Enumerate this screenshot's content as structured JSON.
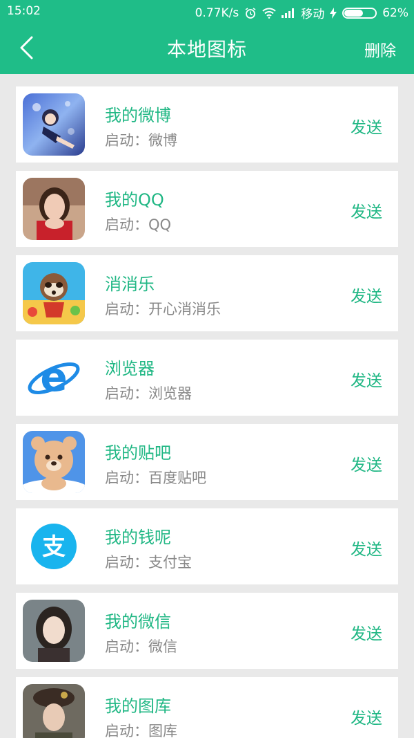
{
  "status": {
    "time": "15:02",
    "speed": "0.77K/s",
    "carrier": "移动",
    "battery": "62%",
    "battery_level": 0.62
  },
  "navbar": {
    "back": "back-arrow",
    "title": "本地图标",
    "action": "删除"
  },
  "items": [
    {
      "title": "我的微博",
      "sub": "启动：微博",
      "send": "发送",
      "icon": "anime-girl-thumbnail"
    },
    {
      "title": "我的QQ",
      "sub": "启动：QQ",
      "send": "发送",
      "icon": "woman-photo-thumbnail"
    },
    {
      "title": "消消乐",
      "sub": "启动：开心消消乐",
      "send": "发送",
      "icon": "raccoon-game-thumbnail"
    },
    {
      "title": "浏览器",
      "sub": "启动：浏览器",
      "send": "发送",
      "icon": "ie-browser-icon"
    },
    {
      "title": "我的贴吧",
      "sub": "启动：百度贴吧",
      "send": "发送",
      "icon": "bear-icon"
    },
    {
      "title": "我的钱呢",
      "sub": "启动：支付宝",
      "send": "发送",
      "icon": "alipay-icon",
      "icon_text": "支"
    },
    {
      "title": "我的微信",
      "sub": "启动：微信",
      "send": "发送",
      "icon": "girl-photo-thumbnail"
    },
    {
      "title": "我的图库",
      "sub": "启动：图库",
      "send": "发送",
      "icon": "soldier-photo-thumbnail"
    }
  ],
  "colors": {
    "accent": "#1fbd88",
    "text_green": "#20b784",
    "sub_gray": "#888888",
    "bg": "#e9e9e9"
  }
}
